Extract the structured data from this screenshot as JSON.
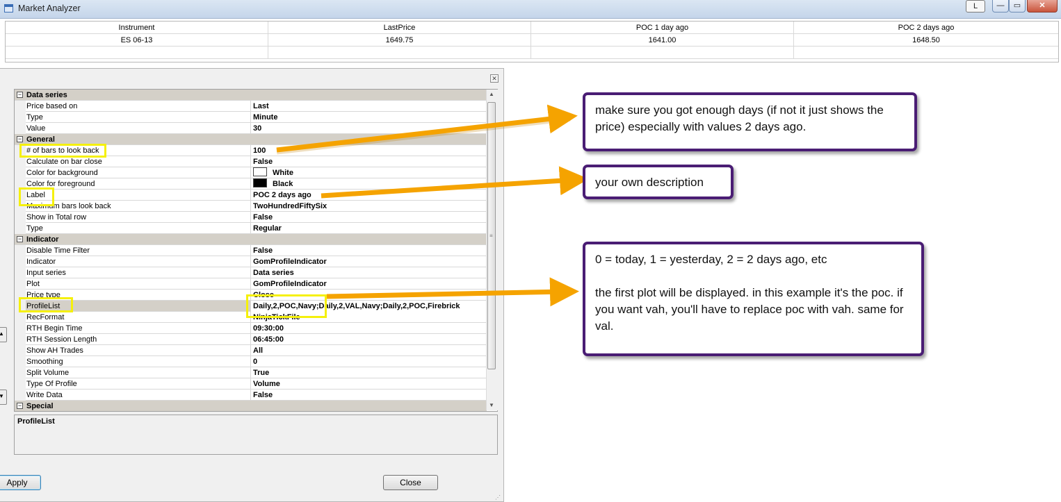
{
  "window": {
    "title": "Market Analyzer",
    "l_button": "L",
    "minimize": "—",
    "maximize": "▭",
    "close": "✕"
  },
  "grid": {
    "columns": [
      "Instrument",
      "LastPrice",
      "POC 1 day ago",
      "POC 2 days ago"
    ],
    "rows": [
      [
        "ES 06-13",
        "1649.75",
        "1641.00",
        "1648.50"
      ]
    ]
  },
  "properties": {
    "categories": {
      "data_series": "Data series",
      "general": "General",
      "indicator": "Indicator",
      "special": "Special"
    },
    "data_series": [
      {
        "name": "Price based on",
        "value": "Last"
      },
      {
        "name": "Type",
        "value": "Minute"
      },
      {
        "name": "Value",
        "value": "30"
      }
    ],
    "general": [
      {
        "name": "# of bars to look back",
        "value": "100"
      },
      {
        "name": "Calculate on bar close",
        "value": "False"
      },
      {
        "name": "Color for background",
        "value": "White"
      },
      {
        "name": "Color for foreground",
        "value": "Black"
      },
      {
        "name": "Label",
        "value": "POC 2 days ago"
      },
      {
        "name": "Maximum bars look back",
        "value": "TwoHundredFiftySix"
      },
      {
        "name": "Show in Total row",
        "value": "False"
      },
      {
        "name": "Type",
        "value": "Regular"
      }
    ],
    "indicator": [
      {
        "name": "Disable Time Filter",
        "value": "False"
      },
      {
        "name": "Indicator",
        "value": "GomProfileIndicator"
      },
      {
        "name": "Input series",
        "value": "Data series"
      },
      {
        "name": "Plot",
        "value": "GomProfileIndicator"
      },
      {
        "name": "Price type",
        "value": "Close"
      },
      {
        "name": "ProfileList",
        "value": "Daily,2,POC,Navy;Daily,2,VAL,Navy;Daily,2,POC,Firebrick"
      },
      {
        "name": "RecFormat",
        "value": "NinjaTickFile"
      },
      {
        "name": "RTH Begin Time",
        "value": "09:30:00"
      },
      {
        "name": "RTH Session Length",
        "value": "06:45:00"
      },
      {
        "name": "Show AH Trades",
        "value": "All"
      },
      {
        "name": "Smoothing",
        "value": "0"
      },
      {
        "name": "Split Volume",
        "value": "True"
      },
      {
        "name": "Type Of Profile",
        "value": "Volume"
      },
      {
        "name": "Write Data",
        "value": "False"
      }
    ],
    "swatch_colors": {
      "white": "#ffffff",
      "black": "#000000"
    },
    "description_title": "ProfileList"
  },
  "buttons": {
    "apply": "Apply",
    "close": "Close"
  },
  "callouts": [
    "make sure you got enough days (if not it just shows the price) especially with values 2 days ago.",
    "your own description",
    "0 = today, 1 = yesterday, 2 = 2 days ago, etc\n\nthe first plot will be displayed. in this example it's the poc. if you want vah, you'll have to replace poc with vah. same for val."
  ],
  "colors": {
    "highlight": "#f5f00c",
    "arrow": "#f5a300",
    "callout_border": "#4a1d74"
  }
}
